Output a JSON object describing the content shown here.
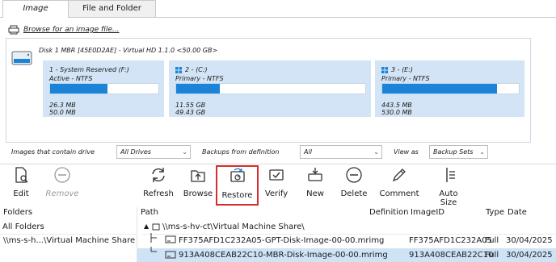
{
  "tabs": [
    {
      "label": "Image"
    },
    {
      "label": "File and Folder"
    }
  ],
  "browse": {
    "label": "Browse for an image file..."
  },
  "disk": {
    "title": "Disk 1 MBR [45E0D2AE] - Virtual HD 1.1.0  <50.00 GB>",
    "partitions": [
      {
        "name": "1 - System Reserved (F:)",
        "type": "Active - NTFS",
        "used": "26.3 MB",
        "total": "50.0 MB",
        "fill_fraction": 0.53
      },
      {
        "name": "2 - (C:)",
        "type": "Primary - NTFS",
        "used": "11.55 GB",
        "total": "49.43 GB",
        "fill_fraction": 0.23
      },
      {
        "name": "3 - (E:)",
        "type": "Primary - NTFS",
        "used": "443.5 MB",
        "total": "530.0 MB",
        "fill_fraction": 0.84
      }
    ]
  },
  "filters": {
    "contain_label": "Images that contain drive",
    "contain_value": "All Drives",
    "backups_label": "Backups from definition",
    "backups_value": "All",
    "view_label": "View as",
    "view_value": "Backup Sets"
  },
  "toolbar": {
    "edit": "Edit",
    "remove": "Remove",
    "refresh": "Refresh",
    "browse": "Browse",
    "restore": "Restore",
    "verify": "Verify",
    "new": "New",
    "delete": "Delete",
    "comment": "Comment",
    "autosize": "Auto Size"
  },
  "folders": {
    "header": "Folders",
    "items": [
      "All Folders",
      "\\\\ms-s-h...\\Virtual Machine Share"
    ]
  },
  "table": {
    "columns": [
      "Path",
      "Definition",
      "ImageID",
      "Type",
      "Date"
    ],
    "root": "\\\\ms-s-hv-ct\\Virtual Machine Share\\",
    "rows": [
      {
        "path": "FF375AFD1C232A05-GPT-Disk-Image-00-00.mrimg",
        "definition": "",
        "image_id": "FF375AFD1C232A05",
        "type": "Full",
        "date": "30/04/2025"
      },
      {
        "path": "913A408CEAB22C10-MBR-Disk-Image-00-00.mrimg",
        "definition": "",
        "image_id": "913A408CEAB22C10",
        "type": "Full",
        "date": "30/04/2025"
      }
    ]
  },
  "colors": {
    "accent": "#1b84d8",
    "partition_bg": "#d2e4f5",
    "selection": "#cfe3f7",
    "highlight_border": "#d32f2f"
  }
}
